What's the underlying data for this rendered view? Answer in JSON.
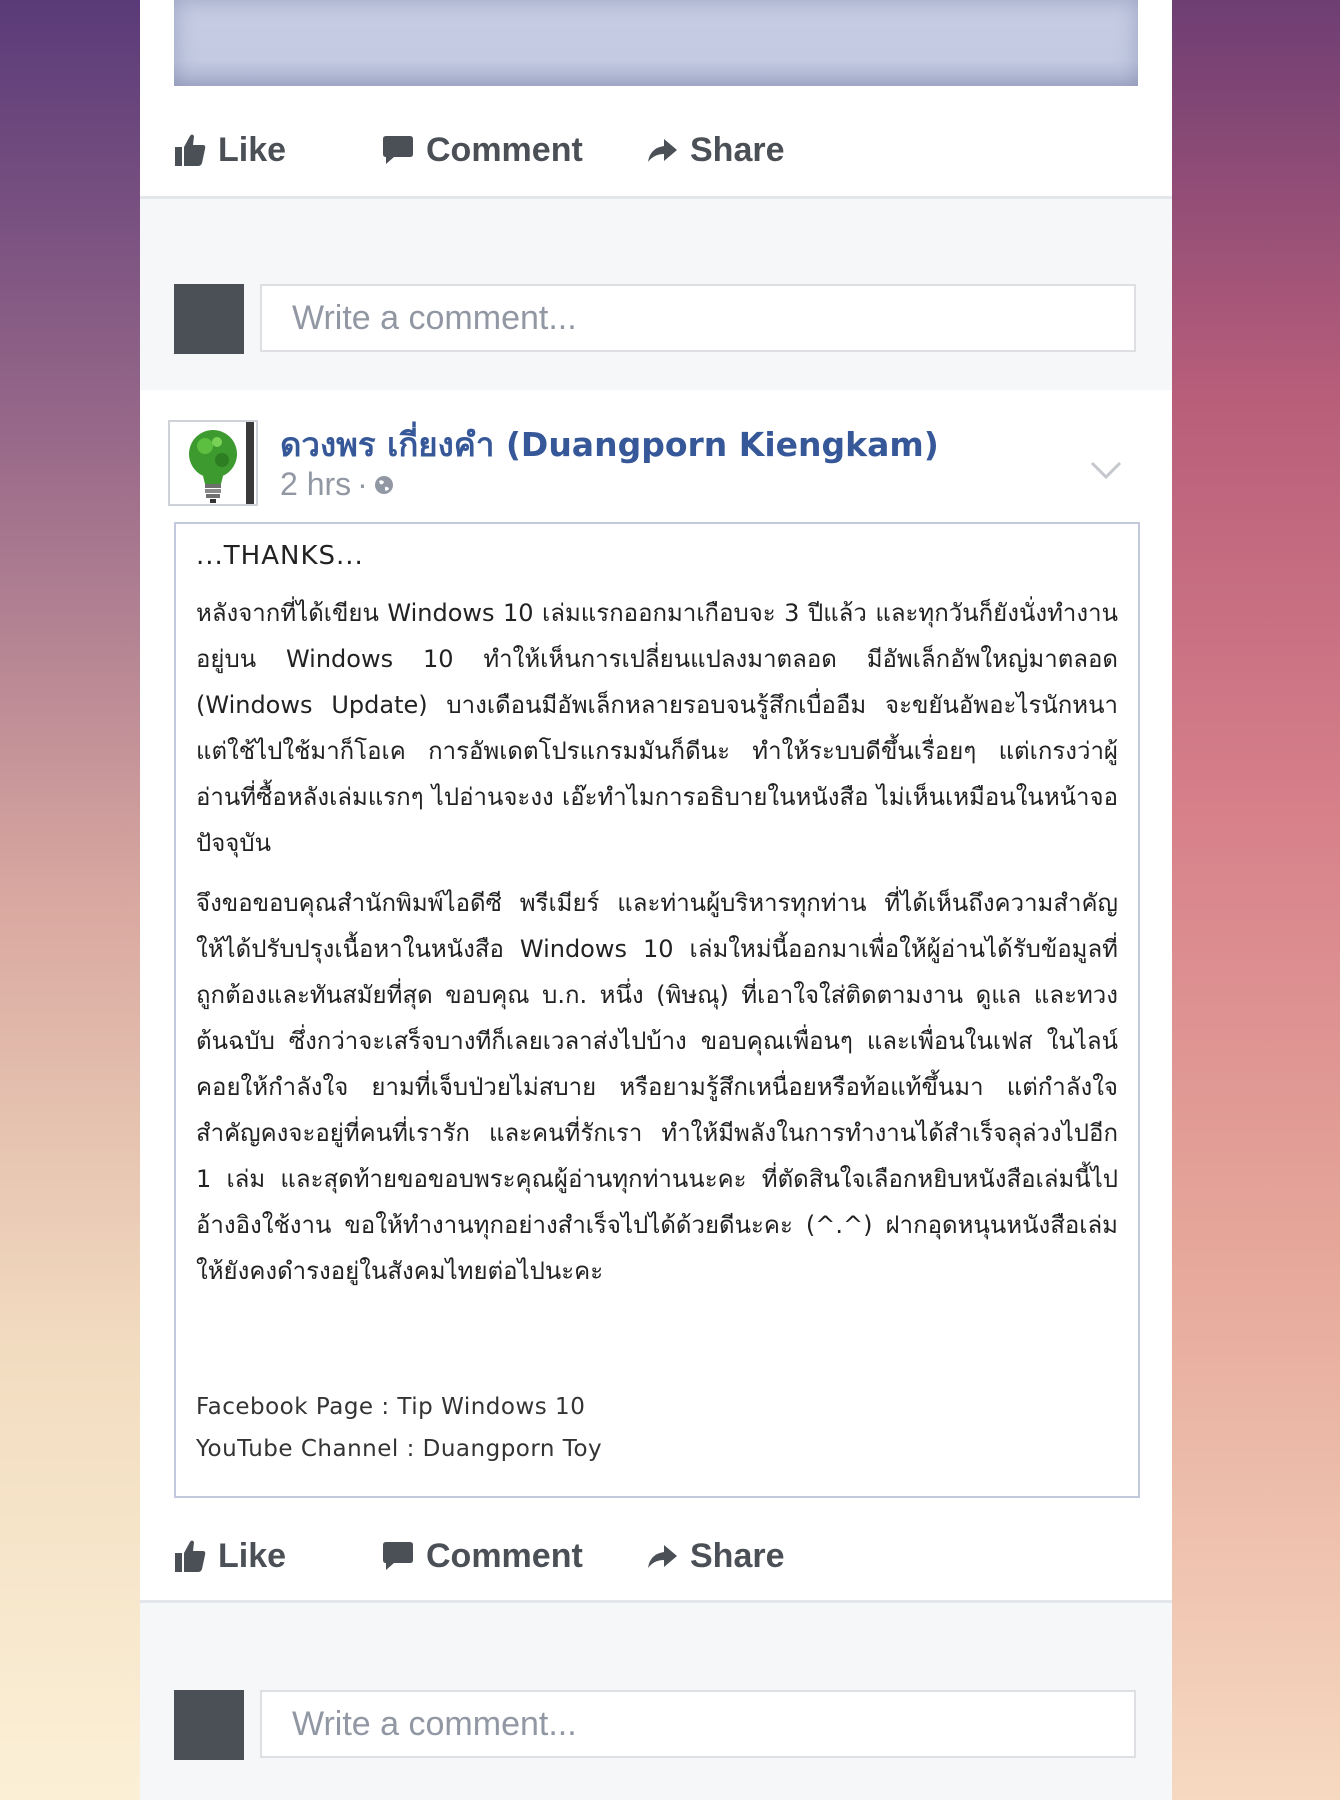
{
  "top_post": {
    "actions": {
      "like": "Like",
      "comment": "Comment",
      "share": "Share"
    }
  },
  "top_comment": {
    "placeholder": "Write a comment..."
  },
  "post": {
    "author": "ดวงพร เกี่ยงคำ (Duangporn Kiengkam)",
    "time": "2 hrs",
    "separator": "·",
    "privacy_icon": "globe-icon",
    "body": {
      "thanks": "...THANKS...",
      "paragraph1": "หลังจากที่ได้เขียน Windows 10 เล่มแรกออกมาเกือบจะ 3 ปีแล้ว และทุกวันก็ยังนั่งทำงานอยู่บน Windows 10 ทำให้เห็นการเปลี่ยนแปลงมาตลอด มีอัพเล็กอัพใหญ่มาตลอด (Windows Update) บางเดือนมีอัพเล็กหลายรอบจนรู้สึกเบื่ออืม จะขยันอัพอะไรนักหนา แต่ใช้ไปใช้มาก็โอเค การอัพเดตโปรแกรมมันก็ดีนะ ทำให้ระบบดีขึ้นเรื่อยๆ แต่เกรงว่าผู้อ่านที่ซื้อหลังเล่มแรกๆ ไปอ่านจะงง เอ๊ะทำไมการอธิบายในหนังสือ ไม่เห็นเหมือนในหน้าจอปัจจุบัน",
      "paragraph2": "จึงขอขอบคุณสำนักพิมพ์ไอดีซี พรีเมียร์ และท่านผู้บริหารทุกท่าน ที่ได้เห็นถึงความสำคัญ ให้ได้ปรับปรุงเนื้อหาในหนังสือ Windows 10 เล่มใหม่นี้ออกมาเพื่อให้ผู้อ่านได้รับข้อมูลที่ถูกต้องและทันสมัยที่สุด ขอบคุณ บ.ก. หนึ่ง (พิษณุ) ที่เอาใจใส่ติดตามงาน ดูแล และทวงต้นฉบับ ซึ่งกว่าจะเสร็จบางทีก็เลยเวลาส่งไปบ้าง ขอบคุณเพื่อนๆ และเพื่อนในเฟส ในไลน์ คอยให้กำลังใจ ยามที่เจ็บป่วยไม่สบาย หรือยามรู้สึกเหนื่อยหรือท้อแท้ขึ้นมา แต่กำลังใจสำคัญคงจะอยู่ที่คนที่เรารัก และคนที่รักเรา ทำให้มีพลังในการทำงานได้สำเร็จลุล่วงไปอีก 1 เล่ม และสุดท้ายขอขอบพระคุณผู้อ่านทุกท่านนะคะ ที่ตัดสินใจเลือกหยิบหนังสือเล่มนี้ไปอ้างอิงใช้งาน ขอให้ทำงานทุกอย่างสำเร็จไปได้ด้วยดีนะคะ (^.^) ฝากอุดหนุนหนังสือเล่มให้ยังคงดำรงอยู่ในสังคมไทยต่อไปนะคะ",
      "facebook_page": "Facebook Page : Tip Windows 10",
      "youtube_channel": "YouTube Channel : Duangporn Toy"
    },
    "actions": {
      "like": "Like",
      "comment": "Comment",
      "share": "Share"
    }
  },
  "bottom_comment": {
    "placeholder": "Write a comment..."
  },
  "colors": {
    "link_blue": "#365899",
    "action_gray": "#4b4f56",
    "placeholder_gray": "#9197a3",
    "frame_border": "#c3c9dd"
  }
}
